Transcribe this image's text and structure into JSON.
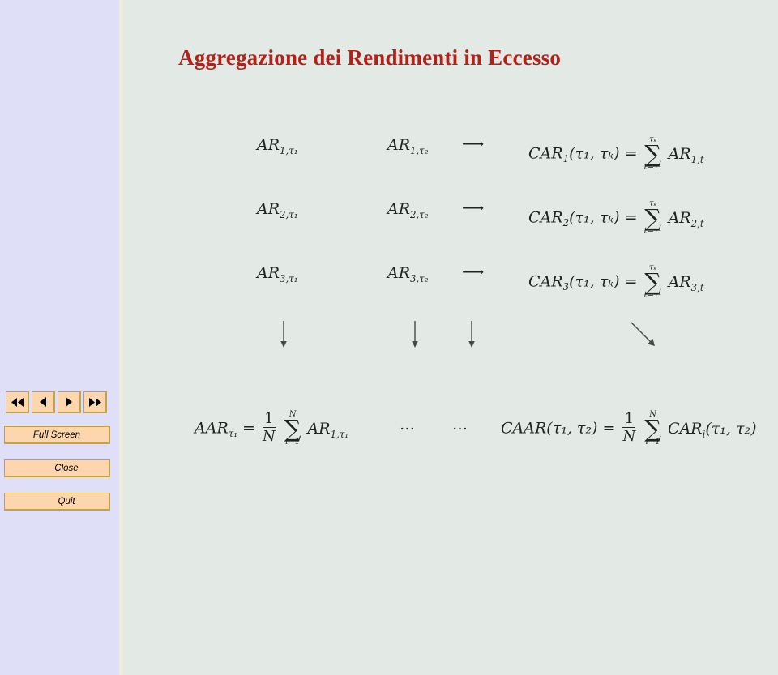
{
  "window": {
    "background_sidebar": "#dfdff7",
    "background_slide": "#e3eae6"
  },
  "nav": {
    "buttons": [
      {
        "name": "first",
        "icon": "double-left-arrow-icon",
        "label": ""
      },
      {
        "name": "previous",
        "icon": "left-arrow-icon",
        "label": ""
      },
      {
        "name": "next",
        "icon": "right-arrow-icon",
        "label": ""
      },
      {
        "name": "last",
        "icon": "double-right-arrow-icon",
        "label": ""
      }
    ],
    "full_screen_label": "Full Screen",
    "close_label": "Close",
    "quit_label": "Quit",
    "button_color": "#fdd6ae",
    "button_border_color": "#c9a13a"
  },
  "slide": {
    "title": "Aggregazione dei Rendimenti in Eccesso",
    "title_color": "#b32118",
    "rows": [
      {
        "left": {
          "base": "AR",
          "sub": "1,τ₁"
        },
        "middle": {
          "base": "AR",
          "sub": "1,τ₂"
        },
        "arrow": "⟶",
        "right": {
          "lhs_base": "CAR",
          "lhs_sub": "1",
          "lhs_args": "(τ₁, τₖ)",
          "equals": "=",
          "sum_upper": "τₖ",
          "sum_lower": "t=τ₁",
          "term_base": "AR",
          "term_sub": "1,t"
        }
      },
      {
        "left": {
          "base": "AR",
          "sub": "2,τ₁"
        },
        "middle": {
          "base": "AR",
          "sub": "2,τ₂"
        },
        "arrow": "⟶",
        "right": {
          "lhs_base": "CAR",
          "lhs_sub": "2",
          "lhs_args": "(τ₁, τₖ)",
          "equals": "=",
          "sum_upper": "τₖ",
          "sum_lower": "t=τ₁",
          "term_base": "AR",
          "term_sub": "2,t"
        }
      },
      {
        "left": {
          "base": "AR",
          "sub": "3,τ₁"
        },
        "middle": {
          "base": "AR",
          "sub": "3,τ₂"
        },
        "arrow": "⟶",
        "right": {
          "lhs_base": "CAR",
          "lhs_sub": "3",
          "lhs_args": "(τ₁, τₖ)",
          "equals": "=",
          "sum_upper": "τₖ",
          "sum_lower": "t=τ₁",
          "term_base": "AR",
          "term_sub": "3,t"
        }
      }
    ],
    "arrows_row": [
      {
        "name": "down-arrow-1",
        "kind": "down"
      },
      {
        "name": "down-arrow-2",
        "kind": "down"
      },
      {
        "name": "down-arrow-3",
        "kind": "down"
      },
      {
        "name": "diagonal-arrow",
        "kind": "diagonal"
      }
    ],
    "bottom": {
      "aar": {
        "lhs_base": "AAR",
        "lhs_sub": "τ₁",
        "equals": "=",
        "frac_num": "1",
        "frac_den": "N",
        "sum_upper": "N",
        "sum_lower": "i=1",
        "term_base": "AR",
        "term_sub": "1,τ₁"
      },
      "dots_1": "…",
      "dots_2": "…",
      "caar": {
        "lhs_base": "CAAR",
        "lhs_args": "(τ₁, τ₂)",
        "equals": "=",
        "frac_num": "1",
        "frac_den": "N",
        "sum_upper": "N",
        "sum_lower": "i=1",
        "term_base": "CAR",
        "term_sub": "i",
        "term_args": "(τ₁, τ₂)"
      }
    }
  }
}
